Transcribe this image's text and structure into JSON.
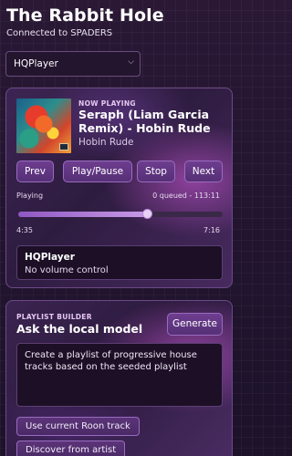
{
  "app": {
    "title": "The Rabbit Hole",
    "connection": "Connected to SPADERS"
  },
  "player_select": {
    "selected": "HQPlayer"
  },
  "now_playing": {
    "label": "NOW PLAYING",
    "title": "Seraph (Liam Garcia Remix) - Hobin Rude",
    "artist": "Hobin Rude",
    "controls": {
      "prev": "Prev",
      "play_pause": "Play/Pause",
      "stop": "Stop",
      "next": "Next"
    },
    "status": "Playing",
    "queue_info": "0 queued - 113:11",
    "elapsed": "4:35",
    "duration": "7:16",
    "progress_fraction": 0.63,
    "zone": {
      "name": "HQPlayer",
      "volume_note": "No volume control"
    }
  },
  "playlist_builder": {
    "label": "PLAYLIST BUILDER",
    "heading": "Ask the local model",
    "generate_label": "Generate",
    "prompt": "Create a playlist of progressive house tracks based on the seeded playlist",
    "use_current_label": "Use current Roon track",
    "discover_label": "Discover from artist"
  },
  "colors": {
    "accent": "#6e3d8f",
    "card_border": "#6c4a86",
    "background": "#231530"
  }
}
